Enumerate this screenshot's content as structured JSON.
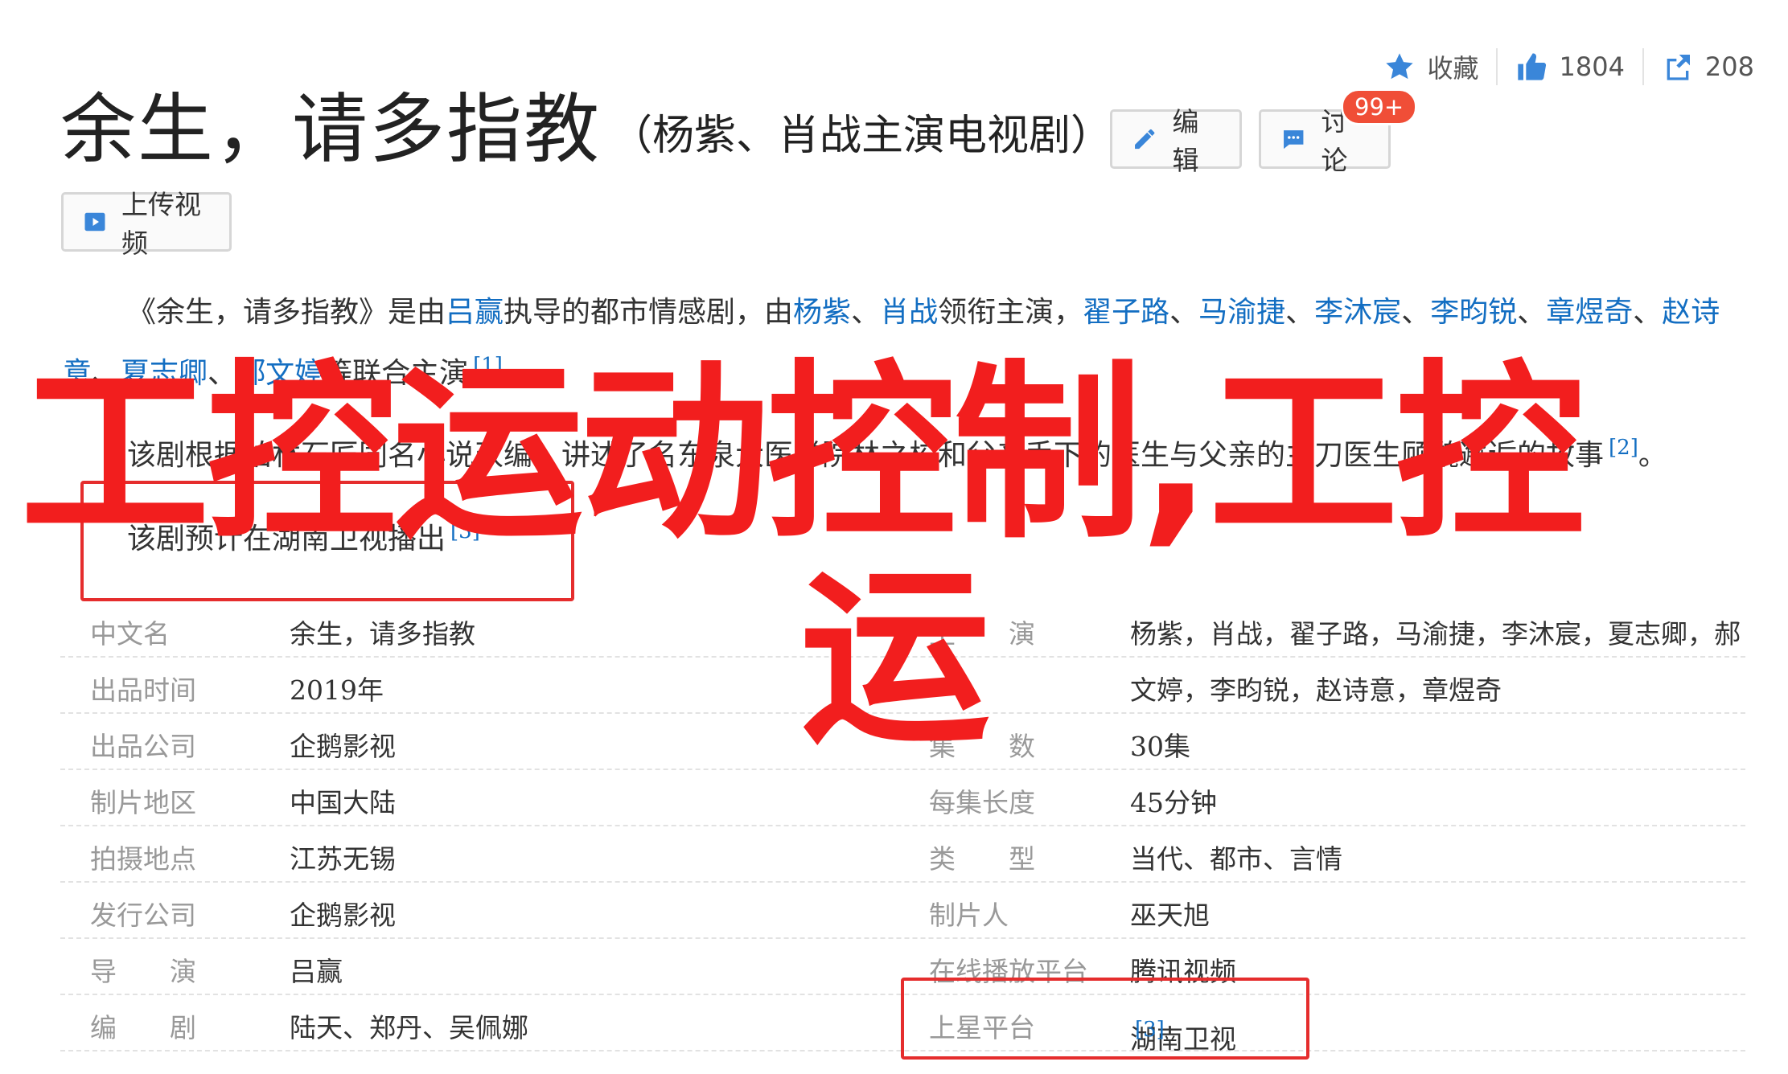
{
  "toolbar": {
    "favorite_label": "收藏",
    "like_count": "1804",
    "share_count": "208"
  },
  "header": {
    "title": "余生，请多指教",
    "subtitle": "（杨紫、肖战主演电视剧）",
    "edit_label": "编辑",
    "discuss_label": "讨论",
    "discuss_badge": "99+",
    "upload_label": "上传视频"
  },
  "intro": {
    "p1": {
      "t1": "《余生，请多指教》是由",
      "director": "吕赢",
      "t2": "执导的都市情感剧，由",
      "a1": "杨紫",
      "sep1": "、",
      "a2": "肖战",
      "t3": "领衔主演，",
      "a3": "翟子路",
      "sep2": "、",
      "a4": "马渝捷",
      "sep3": "、",
      "a5": "李沐宸",
      "sep4": "、",
      "a6": "李昀锐",
      "sep5": "、",
      "a7": "章煜奇",
      "sep6": "、",
      "a8": "赵诗意",
      "sep7": "、",
      "a9": "夏志卿",
      "sep8": "、",
      "a10": "郝文婷",
      "t4": "等联合主演",
      "ref": "[1]",
      "end": "。"
    },
    "p2": {
      "text": "该剧根据柏林石匠同名小说改编，讲述了名东泉大医学院林之校和父亲手下的医生与父亲的主刀医生顾魏邂逅的故事",
      "ref": "[2]",
      "end": "。"
    },
    "p3": {
      "text": "该剧预计在湖南卫视播出",
      "ref": "[3]"
    }
  },
  "info": {
    "rows": [
      {
        "l_label": "中文名",
        "l_val": "余生，请多指教",
        "r_label": "主　　演",
        "r_val": "杨紫，肖战，翟子路，马渝捷，李沐宸，夏志卿，郝"
      },
      {
        "l_label": "出品时间",
        "l_val": "2019年",
        "r_label": "",
        "r_val": "文婷，李昀锐，赵诗意，章煜奇"
      },
      {
        "l_label": "出品公司",
        "l_val": "企鹅影视",
        "r_label": "集　　数",
        "r_val": "30集"
      },
      {
        "l_label": "制片地区",
        "l_val": "中国大陆",
        "r_label": "每集长度",
        "r_val": "45分钟"
      },
      {
        "l_label": "拍摄地点",
        "l_val": "江苏无锡",
        "r_label": "类　　型",
        "r_val": "当代、都市、言情"
      },
      {
        "l_label": "发行公司",
        "l_val": "企鹅影视",
        "r_label": "制片人",
        "r_val": "巫天旭"
      },
      {
        "l_label": "导　　演",
        "l_val": "吕赢",
        "r_label": "在线播放平台",
        "r_val": "腾讯视频"
      },
      {
        "l_label": "编　　剧",
        "l_val": "陆天、郑丹、吴佩娜",
        "r_label": "上星平台",
        "r_val": "湖南卫视"
      }
    ],
    "platform_ref": "[3]"
  },
  "watermark": {
    "line1": "工控运动控制,工控",
    "line2": "运"
  },
  "colors": {
    "link": "#136ec2",
    "watermark": "#f21e1e",
    "badge": "#f04e37",
    "highlight_border": "#e52d2d"
  }
}
